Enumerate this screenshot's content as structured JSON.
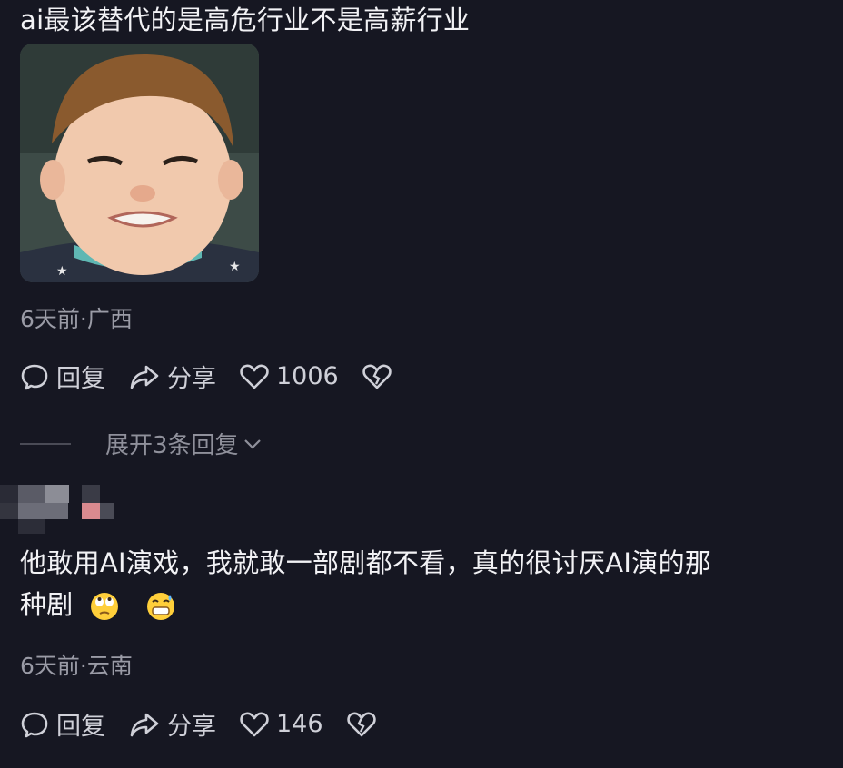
{
  "comments": [
    {
      "text": "ai最该替代的是高危行业不是高薪行业",
      "meta": "6天前·广西",
      "actions": {
        "reply": "回复",
        "share": "分享",
        "likes": "1006"
      }
    },
    {
      "text_line1": "他敢用AI演戏，我就敢一部剧都不看，真的很讨厌AI演的那",
      "text_line2": "种剧",
      "emojis": [
        "eye-roll-emoji",
        "grinning-sweat-emoji"
      ],
      "meta": "6天前·云南",
      "actions": {
        "reply": "回复",
        "share": "分享",
        "likes": "146"
      }
    }
  ],
  "expand_replies": "展开3条回复",
  "icons": [
    "comment-icon",
    "share-arrow-icon",
    "heart-icon",
    "broken-heart-icon",
    "chevron-down-icon"
  ]
}
